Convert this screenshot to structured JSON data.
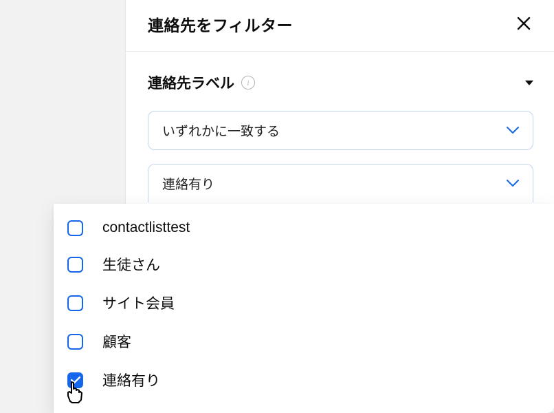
{
  "header": {
    "title": "連絡先をフィルター"
  },
  "section": {
    "title": "連絡先ラベル"
  },
  "selects": {
    "match_mode": "いずれかに一致する",
    "current_label": "連絡有り"
  },
  "options": [
    {
      "label": "contactlisttest",
      "checked": false
    },
    {
      "label": "生徒さん",
      "checked": false
    },
    {
      "label": "サイト会員",
      "checked": false
    },
    {
      "label": "顧客",
      "checked": false
    },
    {
      "label": "連絡有り",
      "checked": true
    }
  ]
}
